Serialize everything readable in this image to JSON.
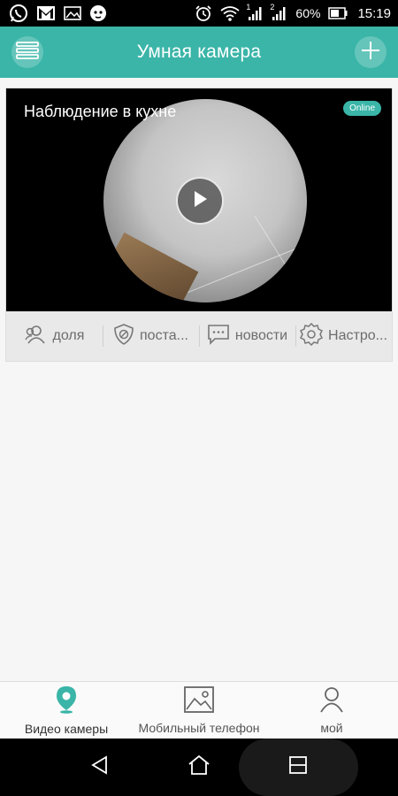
{
  "status_bar": {
    "left_icons": [
      "whatsapp-icon",
      "gmail-icon",
      "gallery-icon",
      "cat-app-icon"
    ],
    "right_icons": [
      "alarm-icon",
      "wifi-icon",
      "signal-sim1-icon",
      "signal-sim2-icon",
      "battery-icon"
    ],
    "sim1_label": "1",
    "sim2_label": "2",
    "battery": "60%",
    "time": "15:19"
  },
  "header": {
    "title": "Умная камера",
    "menu_icon": "menu-icon",
    "add_icon": "plus-icon"
  },
  "camera": {
    "name": "Наблюдение в кухне",
    "status": "Online",
    "play_icon": "play-icon",
    "actions": [
      {
        "label": "доля",
        "icon": "share-users-icon"
      },
      {
        "label": "поста...",
        "icon": "shield-icon"
      },
      {
        "label": "новости",
        "icon": "message-icon"
      },
      {
        "label": "Настро...",
        "icon": "gear-icon"
      }
    ]
  },
  "tabs": [
    {
      "label": "Видео камеры",
      "icon": "location-pin-icon",
      "active": true
    },
    {
      "label": "Мобильный телефон",
      "icon": "image-icon",
      "active": false
    },
    {
      "label": "мой",
      "icon": "person-icon",
      "active": false
    }
  ],
  "colors": {
    "accent": "#3ab5a8",
    "status_bar": "#000000",
    "background": "#f6f6f6"
  },
  "nav": {
    "back_icon": "back-icon",
    "home_icon": "home-icon",
    "recent_icon": "recent-apps-icon"
  }
}
